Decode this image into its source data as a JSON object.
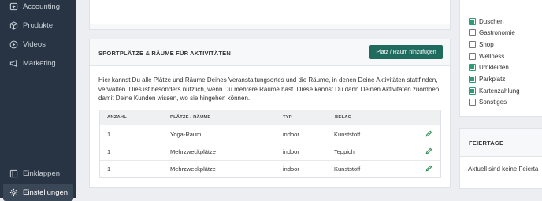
{
  "sidebar": {
    "items": [
      {
        "label": "Accounting",
        "icon": "accounting-icon"
      },
      {
        "label": "Produkte",
        "icon": "box-icon"
      },
      {
        "label": "Videos",
        "icon": "play-circle-icon"
      },
      {
        "label": "Marketing",
        "icon": "megaphone-icon"
      }
    ],
    "collapse_label": "Einklappen",
    "settings_label": "Einstellungen"
  },
  "places_section": {
    "title": "SPORTPLÄTZE & RÄUME FÜR AKTIVITÄTEN",
    "add_button": "Platz / Raum hinzufügen",
    "description": "Hier kannst Du alle Plätze und Räume Deines Veranstaltungsortes und die Räume, in denen Deine Aktivitäten stattfinden, verwalten. Dies ist besonders nützlich, wenn Du mehrere Räume hast. Diese kannst Du dann Deinen Aktivitäten zuordnen, damit Deine Kunden wissen, wo sie hingehen können.",
    "columns": [
      "ANZAHL",
      "PLÄTZE / RÄUME",
      "TYP",
      "BELAG"
    ],
    "rows": [
      {
        "count": "1",
        "name": "Yoga-Raum",
        "type": "indoor",
        "surface": "Kunststoff"
      },
      {
        "count": "1",
        "name": "Mehrzweckplätze",
        "type": "indoor",
        "surface": "Teppich"
      },
      {
        "count": "1",
        "name": "Mehrzweckplätze",
        "type": "indoor",
        "surface": "Kunststoff"
      }
    ]
  },
  "amenities": [
    {
      "label": "Duschen",
      "checked": true
    },
    {
      "label": "Gastronomie",
      "checked": false
    },
    {
      "label": "Shop",
      "checked": false
    },
    {
      "label": "Wellness",
      "checked": false
    },
    {
      "label": "Umkleiden",
      "checked": true
    },
    {
      "label": "Parkplatz",
      "checked": true
    },
    {
      "label": "Kartenzahlung",
      "checked": true
    },
    {
      "label": "Sonstiges",
      "checked": false
    }
  ],
  "holidays": {
    "title": "FEIERTAGE",
    "empty_text": "Aktuell sind keine Feierta"
  },
  "colors": {
    "sidebar": "#283443",
    "accent": "#1f6b5e",
    "checkbox_on": "#2e9b78"
  }
}
